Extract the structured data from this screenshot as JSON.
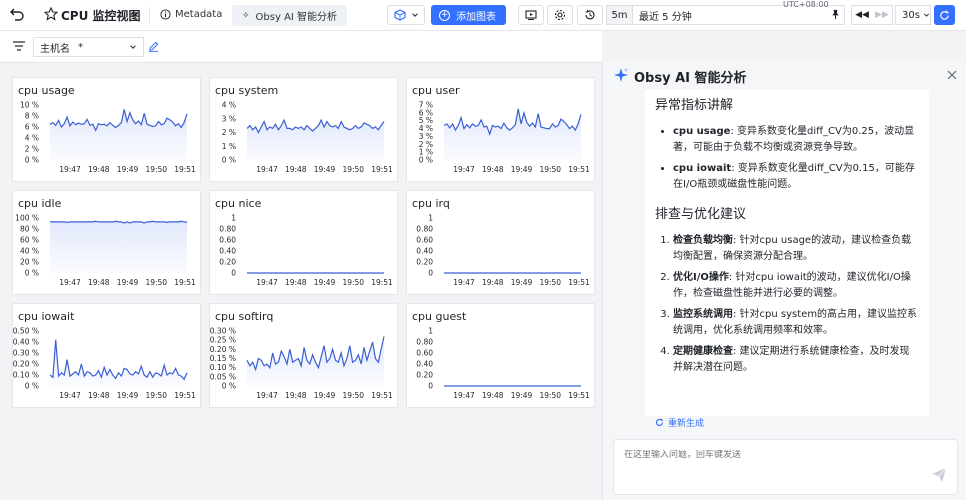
{
  "toolbar": {
    "back_icon": "back-arrow-icon",
    "title": "CPU 监控视图",
    "metadata_label": "Metadata",
    "ai_tab_label": "Obsy AI 智能分析",
    "add_chart_label": "添加图表",
    "time_unit": "5m",
    "time_range": "最近 5 分钟",
    "timezone": "UTC+08:00",
    "refresh_interval": "30s"
  },
  "filter": {
    "host_label": "主机名",
    "host_value": "*"
  },
  "x_ticks": [
    "19:47",
    "19:48",
    "19:49",
    "19:50",
    "19:51"
  ],
  "panels": [
    {
      "title": "cpu usage",
      "yticks": [
        "10 %",
        "8 %",
        "6 %",
        "4 %",
        "2 %",
        "0 %"
      ]
    },
    {
      "title": "cpu system",
      "yticks": [
        "4 %",
        "3 %",
        "2 %",
        "1 %",
        "0 %"
      ]
    },
    {
      "title": "cpu user",
      "yticks": [
        "7 %",
        "6 %",
        "5 %",
        "4 %",
        "3 %",
        "2 %",
        "1 %",
        "0 %"
      ]
    },
    {
      "title": "cpu idle",
      "yticks": [
        "100 %",
        "80 %",
        "60 %",
        "40 %",
        "20 %",
        "0 %"
      ]
    },
    {
      "title": "cpu nice",
      "yticks": [
        "1",
        "0.80",
        "0.60",
        "0.40",
        "0.20",
        "0"
      ]
    },
    {
      "title": "cpu irq",
      "yticks": [
        "1",
        "0.80",
        "0.60",
        "0.40",
        "0.20",
        "0"
      ]
    },
    {
      "title": "cpu iowait",
      "yticks": [
        "0.50 %",
        "0.40 %",
        "0.30 %",
        "0.20 %",
        "0.10 %",
        "0 %"
      ]
    },
    {
      "title": "cpu softirq",
      "yticks": [
        "0.30 %",
        "0.25 %",
        "0.20 %",
        "0.15 %",
        "0.10 %",
        "0.05 %",
        "0 %"
      ]
    },
    {
      "title": "cpu guest",
      "yticks": [
        "1",
        "0.80",
        "0.60",
        "0.40",
        "0.20",
        "0"
      ]
    }
  ],
  "chart_data": [
    {
      "type": "area",
      "title": "cpu usage",
      "x": [
        "19:47",
        "19:48",
        "19:49",
        "19:50",
        "19:51"
      ],
      "ylim": [
        0,
        10
      ],
      "values": [
        6.5,
        6.8,
        6.3,
        7.2,
        6.0,
        6.6,
        7.8,
        6.2,
        6.9,
        6.4,
        6.7,
        6.5,
        6.6,
        7.4,
        6.3,
        6.5,
        5.4,
        6.6,
        6.4,
        6.5,
        6.2,
        6.8,
        6.3,
        5.9,
        6.3,
        6.8,
        9.2,
        7.0,
        8.6,
        7.3,
        6.6,
        7.1,
        6.4,
        8.5,
        6.5,
        6.3,
        6.1,
        6.2,
        7.0,
        6.4,
        6.6,
        7.6,
        7.3,
        6.9,
        6.2,
        6.6,
        5.9,
        6.8,
        8.4
      ]
    },
    {
      "type": "area",
      "title": "cpu system",
      "x": [
        "19:47",
        "19:48",
        "19:49",
        "19:50",
        "19:51"
      ],
      "ylim": [
        0,
        4
      ],
      "values": [
        2.3,
        2.5,
        2.2,
        2.4,
        2.0,
        2.4,
        2.8,
        2.2,
        2.4,
        2.3,
        2.6,
        2.2,
        2.5,
        2.9,
        2.3,
        2.3,
        2.2,
        2.4,
        2.3,
        2.4,
        2.2,
        2.5,
        2.3,
        2.1,
        2.3,
        2.5,
        2.9,
        2.4,
        2.8,
        2.5,
        2.4,
        2.5,
        2.3,
        2.8,
        2.4,
        2.3,
        2.2,
        2.3,
        2.5,
        2.3,
        2.4,
        2.7,
        2.6,
        2.5,
        2.3,
        2.4,
        2.2,
        2.5,
        2.8
      ]
    },
    {
      "type": "area",
      "title": "cpu user",
      "x": [
        "19:47",
        "19:48",
        "19:49",
        "19:50",
        "19:51"
      ],
      "ylim": [
        0,
        7
      ],
      "values": [
        4.4,
        4.6,
        4.1,
        4.6,
        3.8,
        4.4,
        5.4,
        4.0,
        4.5,
        4.1,
        4.6,
        4.3,
        4.4,
        5.1,
        4.2,
        4.3,
        3.3,
        4.4,
        4.2,
        4.3,
        4.0,
        4.7,
        4.1,
        3.8,
        4.1,
        4.5,
        6.5,
        4.6,
        6.0,
        4.8,
        4.3,
        4.7,
        4.2,
        5.9,
        4.2,
        4.1,
        4.0,
        4.0,
        4.6,
        4.2,
        4.4,
        5.2,
        4.9,
        4.5,
        4.0,
        4.3,
        3.8,
        4.6,
        5.8
      ]
    },
    {
      "type": "area",
      "title": "cpu idle",
      "x": [
        "19:47",
        "19:48",
        "19:49",
        "19:50",
        "19:51"
      ],
      "ylim": [
        0,
        100
      ],
      "values": [
        93,
        93,
        93,
        93,
        93,
        93,
        92,
        93,
        93,
        93,
        93,
        93,
        93,
        93,
        93,
        93,
        94,
        93,
        93,
        93,
        93,
        93,
        93,
        94,
        93,
        93,
        91,
        93,
        91,
        93,
        93,
        93,
        93,
        91,
        93,
        93,
        94,
        93,
        93,
        93,
        93,
        92,
        93,
        93,
        93,
        93,
        94,
        93,
        92
      ]
    },
    {
      "type": "line",
      "title": "cpu nice",
      "x": [
        "19:47",
        "19:48",
        "19:49",
        "19:50",
        "19:51"
      ],
      "ylim": [
        0,
        1
      ],
      "values": [
        0,
        0
      ]
    },
    {
      "type": "line",
      "title": "cpu irq",
      "x": [
        "19:47",
        "19:48",
        "19:49",
        "19:50",
        "19:51"
      ],
      "ylim": [
        0,
        1
      ],
      "values": [
        0,
        0
      ]
    },
    {
      "type": "area",
      "title": "cpu iowait",
      "x": [
        "19:47",
        "19:48",
        "19:49",
        "19:50",
        "19:51"
      ],
      "ylim": [
        0,
        0.5
      ],
      "values": [
        0.1,
        0.08,
        0.42,
        0.09,
        0.12,
        0.1,
        0.24,
        0.09,
        0.11,
        0.13,
        0.1,
        0.2,
        0.09,
        0.13,
        0.12,
        0.09,
        0.1,
        0.14,
        0.08,
        0.17,
        0.1,
        0.15,
        0.1,
        0.07,
        0.12,
        0.09,
        0.16,
        0.15,
        0.11,
        0.1,
        0.13,
        0.11,
        0.18,
        0.1,
        0.08,
        0.13,
        0.08,
        0.12,
        0.11,
        0.09,
        0.19,
        0.1,
        0.12,
        0.11,
        0.16,
        0.1,
        0.09,
        0.06,
        0.12
      ]
    },
    {
      "type": "area",
      "title": "cpu softirq",
      "x": [
        "19:47",
        "19:48",
        "19:49",
        "19:50",
        "19:51"
      ],
      "ylim": [
        0,
        0.3
      ],
      "values": [
        0.14,
        0.11,
        0.13,
        0.09,
        0.15,
        0.14,
        0.11,
        0.12,
        0.1,
        0.18,
        0.12,
        0.13,
        0.19,
        0.16,
        0.12,
        0.2,
        0.13,
        0.14,
        0.15,
        0.11,
        0.21,
        0.14,
        0.12,
        0.17,
        0.13,
        0.1,
        0.16,
        0.22,
        0.13,
        0.15,
        0.2,
        0.14,
        0.13,
        0.18,
        0.11,
        0.15,
        0.22,
        0.13,
        0.14,
        0.17,
        0.12,
        0.21,
        0.14,
        0.19,
        0.24,
        0.15,
        0.13,
        0.2,
        0.27
      ]
    },
    {
      "type": "line",
      "title": "cpu guest",
      "x": [
        "19:47",
        "19:48",
        "19:49",
        "19:50",
        "19:51"
      ],
      "ylim": [
        0,
        1
      ],
      "values": [
        0,
        0
      ]
    }
  ],
  "ai": {
    "title": "Obsy AI 智能分析",
    "section1_title": "异常指标讲解",
    "bullet1_metric": "cpu usage",
    "bullet1_text": ": 变异系数变化量diff_CV为0.25，波动显著，可能由于负载不均衡或资源竞争导致。",
    "bullet2_metric": "cpu iowait",
    "bullet2_text": ": 变异系数变化量diff_CV为0.15，可能存在I/O瓶颈或磁盘性能问题。",
    "section2_title": "排查与优化建议",
    "items": [
      {
        "bold": "检查负载均衡",
        "text": ": 针对cpu usage的波动，建议检查负载均衡配置，确保资源分配合理。"
      },
      {
        "bold": "优化I/O操作",
        "text": ": 针对cpu iowait的波动，建议优化I/O操作，检查磁盘性能并进行必要的调整。"
      },
      {
        "bold": "监控系统调用",
        "text": ": 针对cpu system的高占用，建议监控系统调用，优化系统调用频率和效率。"
      },
      {
        "bold": "定期健康检查",
        "text": ": 建议定期进行系统健康检查，及时发现并解决潜在问题。"
      }
    ],
    "regenerate_label": "重新生成",
    "input_placeholder": "在这里输入问题，回车键发送"
  },
  "colors": {
    "accent": "#3370ff",
    "series_line": "#3a5fd4",
    "series_fill": "#dfe6fb"
  }
}
